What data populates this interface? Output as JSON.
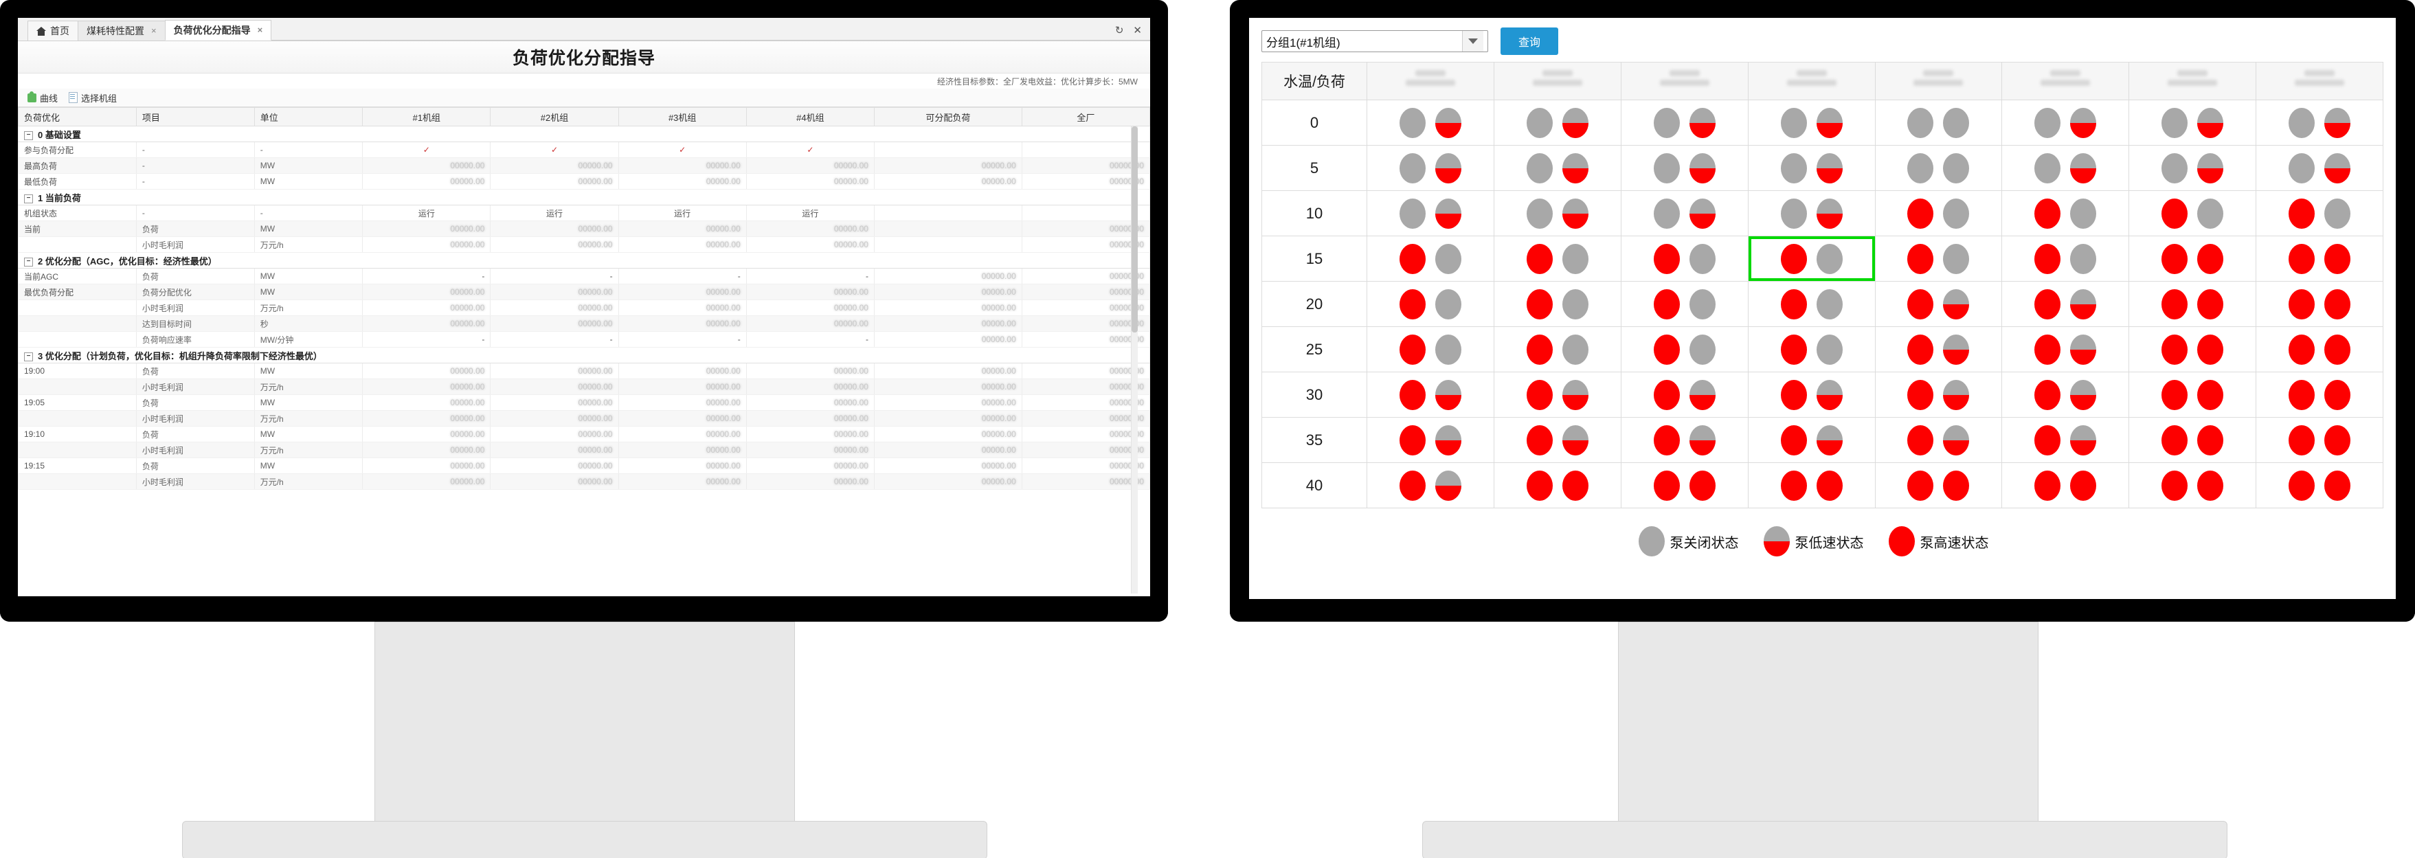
{
  "left_window": {
    "tabs": [
      {
        "label": "首页",
        "icon": "home-icon",
        "closable": false,
        "active": false
      },
      {
        "label": "煤耗特性配置",
        "closable": true,
        "active": false
      },
      {
        "label": "负荷优化分配指导",
        "closable": true,
        "active": true
      }
    ],
    "window_buttons": [
      "refresh-icon",
      "close-icon"
    ],
    "title": "负荷优化分配指导",
    "econ_line": "经济性目标参数：全厂发电效益：优化计算步长：5MW",
    "toolbar": [
      {
        "label": "曲线",
        "icon": "curve-icon"
      },
      {
        "label": "选择机组",
        "icon": "select-unit-icon"
      }
    ],
    "columns": [
      "负荷优化",
      "项目",
      "单位",
      "#1机组",
      "#2机组",
      "#3机组",
      "#4机组",
      "可分配负荷",
      "全厂"
    ],
    "rows": [
      {
        "type": "group",
        "label": "0 基础设置"
      },
      {
        "type": "data",
        "label": "参与负荷分配",
        "item": "-",
        "unit": "-",
        "u1": "✓",
        "u2": "✓",
        "u3": "✓",
        "u4": "✓",
        "alloc": "",
        "plant": "",
        "mark": true
      },
      {
        "type": "data",
        "label": "最高负荷",
        "item": "-",
        "unit": "MW",
        "u1": "···",
        "u2": "···",
        "u3": "···",
        "u4": "···",
        "alloc": "···",
        "plant": "···"
      },
      {
        "type": "data",
        "label": "最低负荷",
        "item": "-",
        "unit": "MW",
        "u1": "···",
        "u2": "···",
        "u3": "···",
        "u4": "···",
        "alloc": "···",
        "plant": "···"
      },
      {
        "type": "group",
        "label": "1 当前负荷"
      },
      {
        "type": "data",
        "label": "机组状态",
        "item": "-",
        "unit": "-",
        "u1": "运行",
        "u2": "运行",
        "u3": "运行",
        "u4": "运行",
        "alloc": "",
        "plant": "",
        "state": true
      },
      {
        "type": "data",
        "label": "当前",
        "item": "负荷",
        "unit": "MW",
        "u1": "···",
        "u2": "···",
        "u3": "···",
        "u4": "···",
        "alloc": "",
        "plant": "···"
      },
      {
        "type": "data",
        "label": "",
        "item": "小时毛利润",
        "unit": "万元/h",
        "u1": "···",
        "u2": "···",
        "u3": "···",
        "u4": "···",
        "alloc": "",
        "plant": "···"
      },
      {
        "type": "group",
        "label": "2 优化分配（AGC，优化目标：经济性最优）"
      },
      {
        "type": "data",
        "label": "当前AGC",
        "item": "负荷",
        "unit": "MW",
        "u1": "-",
        "u2": "-",
        "u3": "-",
        "u4": "-",
        "alloc": "···",
        "plant": "···"
      },
      {
        "type": "data",
        "label": "最优负荷分配",
        "item": "负荷分配优化",
        "unit": "MW",
        "u1": "···",
        "u2": "···",
        "u3": "···",
        "u4": "···",
        "alloc": "···",
        "plant": "···"
      },
      {
        "type": "data",
        "label": "",
        "item": "小时毛利润",
        "unit": "万元/h",
        "u1": "···",
        "u2": "···",
        "u3": "···",
        "u4": "···",
        "alloc": "···",
        "plant": "···"
      },
      {
        "type": "data",
        "label": "",
        "item": "达到目标时间",
        "unit": "秒",
        "u1": "···",
        "u2": "···",
        "u3": "···",
        "u4": "···",
        "alloc": "···",
        "plant": "···"
      },
      {
        "type": "data",
        "label": "",
        "item": "负荷响应速率",
        "unit": "MW/分钟",
        "u1": "-",
        "u2": "-",
        "u3": "-",
        "u4": "-",
        "alloc": "···",
        "plant": "···"
      },
      {
        "type": "group",
        "label": "3 优化分配（计划负荷，优化目标：机组升降负荷率限制下经济性最优）"
      },
      {
        "type": "data",
        "label": "19:00",
        "item": "负荷",
        "unit": "MW",
        "u1": "···",
        "u2": "···",
        "u3": "···",
        "u4": "···",
        "alloc": "···",
        "plant": "···"
      },
      {
        "type": "data",
        "label": "",
        "item": "小时毛利润",
        "unit": "万元/h",
        "u1": "···",
        "u2": "···",
        "u3": "···",
        "u4": "···",
        "alloc": "···",
        "plant": "···"
      },
      {
        "type": "data",
        "label": "19:05",
        "item": "负荷",
        "unit": "MW",
        "u1": "···",
        "u2": "···",
        "u3": "···",
        "u4": "···",
        "alloc": "···",
        "plant": "···"
      },
      {
        "type": "data",
        "label": "",
        "item": "小时毛利润",
        "unit": "万元/h",
        "u1": "···",
        "u2": "···",
        "u3": "···",
        "u4": "···",
        "alloc": "···",
        "plant": "···"
      },
      {
        "type": "data",
        "label": "19:10",
        "item": "负荷",
        "unit": "MW",
        "u1": "···",
        "u2": "···",
        "u3": "···",
        "u4": "···",
        "alloc": "···",
        "plant": "···"
      },
      {
        "type": "data",
        "label": "",
        "item": "小时毛利润",
        "unit": "万元/h",
        "u1": "···",
        "u2": "···",
        "u3": "···",
        "u4": "···",
        "alloc": "···",
        "plant": "···"
      },
      {
        "type": "data",
        "label": "19:15",
        "item": "负荷",
        "unit": "MW",
        "u1": "···",
        "u2": "···",
        "u3": "···",
        "u4": "···",
        "alloc": "···",
        "plant": "···"
      },
      {
        "type": "data",
        "label": "",
        "item": "小时毛利润",
        "unit": "万元/h",
        "u1": "···",
        "u2": "···",
        "u3": "···",
        "u4": "···",
        "alloc": "···",
        "plant": "···"
      }
    ]
  },
  "right_window": {
    "group_select": {
      "value": "分组1(#1机组)",
      "icon": "chevron-down-icon"
    },
    "query_button": "查询",
    "row_header": "水温/负荷",
    "column_count": 8,
    "row_labels": [
      "0",
      "5",
      "10",
      "15",
      "20",
      "25",
      "30",
      "35",
      "40"
    ],
    "legend": [
      {
        "label": "泵关闭状态",
        "state": "off",
        "color": "#a8a8a8"
      },
      {
        "label": "泵低速状态",
        "state": "low",
        "color": "#fd0000"
      },
      {
        "label": "泵高速状态",
        "state": "high",
        "color": "#fd0000"
      }
    ],
    "accent_color": "#2196d3",
    "selection_color": "#00d900",
    "selected_cell": {
      "row": 3,
      "col": 3
    },
    "chart_data": {
      "type": "heatmap",
      "title": "水温/负荷 泵状态矩阵",
      "xlabel": "负荷",
      "ylabel": "水温",
      "categories": [
        "0",
        "5",
        "10",
        "15",
        "20",
        "25",
        "30",
        "35",
        "40"
      ],
      "states_legend": {
        "off": "泵关闭状态",
        "low": "泵低速状态",
        "high": "泵高速状态"
      },
      "matrix": [
        [
          [
            "off",
            "low"
          ],
          [
            "off",
            "low"
          ],
          [
            "off",
            "low"
          ],
          [
            "off",
            "low"
          ],
          [
            "off",
            "off"
          ],
          [
            "off",
            "low"
          ],
          [
            "off",
            "low"
          ],
          [
            "off",
            "low"
          ]
        ],
        [
          [
            "off",
            "low"
          ],
          [
            "off",
            "low"
          ],
          [
            "off",
            "low"
          ],
          [
            "off",
            "low"
          ],
          [
            "off",
            "off"
          ],
          [
            "off",
            "low"
          ],
          [
            "off",
            "low"
          ],
          [
            "off",
            "low"
          ]
        ],
        [
          [
            "off",
            "low"
          ],
          [
            "off",
            "low"
          ],
          [
            "off",
            "low"
          ],
          [
            "off",
            "low"
          ],
          [
            "high",
            "off"
          ],
          [
            "high",
            "off"
          ],
          [
            "high",
            "off"
          ],
          [
            "high",
            "off"
          ]
        ],
        [
          [
            "high",
            "off"
          ],
          [
            "high",
            "off"
          ],
          [
            "high",
            "off"
          ],
          [
            "high",
            "off"
          ],
          [
            "high",
            "off"
          ],
          [
            "high",
            "off"
          ],
          [
            "high",
            "high"
          ],
          [
            "high",
            "high"
          ]
        ],
        [
          [
            "high",
            "off"
          ],
          [
            "high",
            "off"
          ],
          [
            "high",
            "off"
          ],
          [
            "high",
            "off"
          ],
          [
            "high",
            "low"
          ],
          [
            "high",
            "low"
          ],
          [
            "high",
            "high"
          ],
          [
            "high",
            "high"
          ]
        ],
        [
          [
            "high",
            "off"
          ],
          [
            "high",
            "off"
          ],
          [
            "high",
            "off"
          ],
          [
            "high",
            "off"
          ],
          [
            "high",
            "low"
          ],
          [
            "high",
            "low"
          ],
          [
            "high",
            "high"
          ],
          [
            "high",
            "high"
          ]
        ],
        [
          [
            "high",
            "low"
          ],
          [
            "high",
            "low"
          ],
          [
            "high",
            "low"
          ],
          [
            "high",
            "low"
          ],
          [
            "high",
            "low"
          ],
          [
            "high",
            "low"
          ],
          [
            "high",
            "high"
          ],
          [
            "high",
            "high"
          ]
        ],
        [
          [
            "high",
            "low"
          ],
          [
            "high",
            "low"
          ],
          [
            "high",
            "low"
          ],
          [
            "high",
            "low"
          ],
          [
            "high",
            "low"
          ],
          [
            "high",
            "low"
          ],
          [
            "high",
            "high"
          ],
          [
            "high",
            "high"
          ]
        ],
        [
          [
            "high",
            "low"
          ],
          [
            "high",
            "high"
          ],
          [
            "high",
            "high"
          ],
          [
            "high",
            "high"
          ],
          [
            "high",
            "high"
          ],
          [
            "high",
            "high"
          ],
          [
            "high",
            "high"
          ],
          [
            "high",
            "high"
          ]
        ]
      ]
    }
  }
}
